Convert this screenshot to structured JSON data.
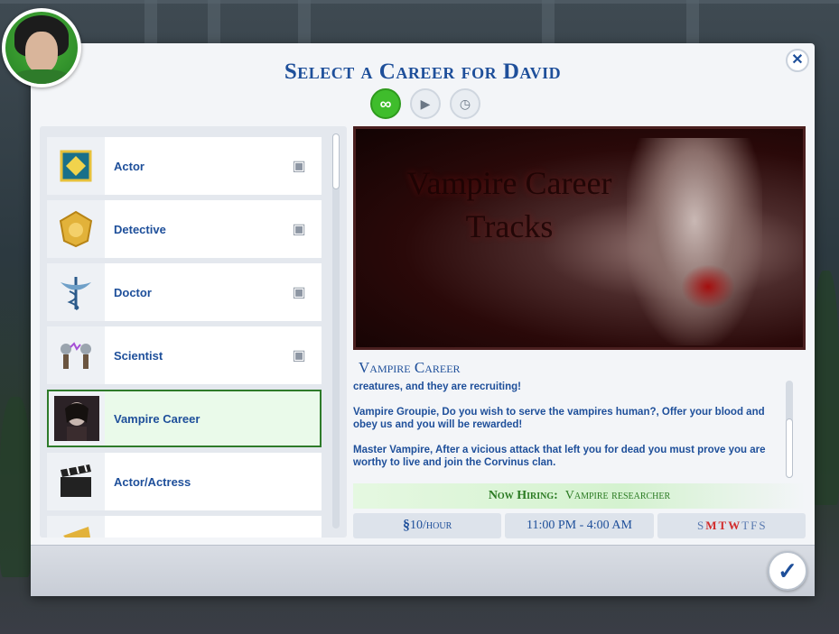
{
  "dialog": {
    "title": "Select a Career for David",
    "close_icon": "close-icon",
    "confirm_icon": "checkmark-icon"
  },
  "filters": [
    {
      "icon": "infinity-icon",
      "glyph": "∞",
      "active": true
    },
    {
      "icon": "briefcase-play-icon",
      "glyph": "▶",
      "active": false
    },
    {
      "icon": "briefcase-clock-icon",
      "glyph": "◷",
      "active": false
    }
  ],
  "careers": [
    {
      "label": "Actor",
      "icon": "actor-badge-icon",
      "badge": "briefcase-play-icon"
    },
    {
      "label": "Detective",
      "icon": "detective-badge-icon",
      "badge": "briefcase-play-icon"
    },
    {
      "label": "Doctor",
      "icon": "caduceus-icon",
      "badge": "briefcase-play-icon"
    },
    {
      "label": "Scientist",
      "icon": "tesla-coil-icon",
      "badge": "briefcase-play-icon"
    },
    {
      "label": "Vampire Career",
      "icon": "vampire-portrait-icon",
      "selected": true
    },
    {
      "label": "Actor/Actress",
      "icon": "clapperboard-icon"
    }
  ],
  "detail": {
    "hero_title": "Vampire Career Tracks",
    "career_name": "Vampire Career",
    "description": [
      "creatures, and they are recruiting!",
      "Vampire Groupie, Do you wish to serve the vampires human?, Offer your blood and obey us and you will be rewarded!",
      "Master Vampire, After a vicious attack that left you for dead you must prove you are worthy to live and join the Corvinus clan."
    ],
    "hiring_label": "Now Hiring:",
    "hiring_position": "Vampire researcher",
    "pay_symbol": "§",
    "pay": "10/hour",
    "hours": "11:00 PM - 4:00 AM",
    "days": [
      {
        "d": "S",
        "work": false
      },
      {
        "d": "M",
        "work": true
      },
      {
        "d": "T",
        "work": true
      },
      {
        "d": "W",
        "work": true
      },
      {
        "d": "T",
        "work": false
      },
      {
        "d": "F",
        "work": false
      },
      {
        "d": "S",
        "work": false
      }
    ]
  }
}
